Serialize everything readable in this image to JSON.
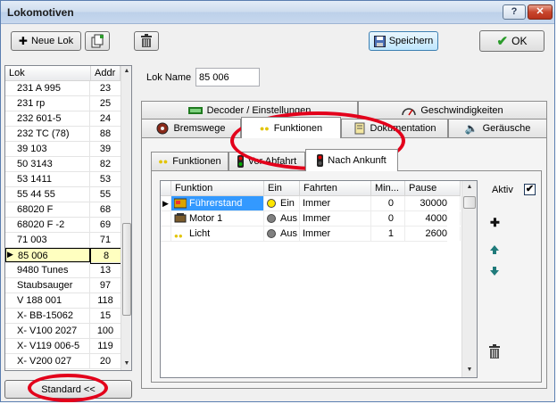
{
  "window": {
    "title": "Lokomotiven",
    "help_label": "?",
    "close_label": "✕"
  },
  "toolbar": {
    "new_loco_label": "Neue Lok",
    "save_label": "Speichern",
    "ok_label": "OK"
  },
  "loco_list": {
    "col_lok": "Lok",
    "col_addr": "Addr",
    "rows": [
      {
        "name": "231 A 995",
        "addr": "23"
      },
      {
        "name": "231 rp",
        "addr": "25"
      },
      {
        "name": "232 601-5",
        "addr": "24"
      },
      {
        "name": "232 TC (78)",
        "addr": "88"
      },
      {
        "name": "39 103",
        "addr": "39"
      },
      {
        "name": "50 3143",
        "addr": "82"
      },
      {
        "name": "53 1411",
        "addr": "53"
      },
      {
        "name": "55 44 55",
        "addr": "55"
      },
      {
        "name": "68020 F",
        "addr": "68"
      },
      {
        "name": "68020 F -2",
        "addr": "69"
      },
      {
        "name": "71 003",
        "addr": "71"
      },
      {
        "name": "85 006",
        "addr": "8"
      },
      {
        "name": "9480 Tunes",
        "addr": "13"
      },
      {
        "name": "Staubsauger",
        "addr": "97"
      },
      {
        "name": "V 188 001",
        "addr": "118"
      },
      {
        "name": "X- BB-15062",
        "addr": "15"
      },
      {
        "name": "X- V100 2027",
        "addr": "100"
      },
      {
        "name": "X- V119 006-5",
        "addr": "119"
      },
      {
        "name": "X- V200 027",
        "addr": "20"
      }
    ],
    "selected_index": 11,
    "standard_label": "Standard <<"
  },
  "lok_name": {
    "label": "Lok Name",
    "value": "85 006"
  },
  "tabs_top": [
    {
      "label": "Decoder / Einstellungen"
    },
    {
      "label": "Geschwindigkeiten"
    }
  ],
  "tabs_main": [
    {
      "label": "Bremswege"
    },
    {
      "label": "Funktionen"
    },
    {
      "label": "Dokumentation"
    },
    {
      "label": "Geräusche"
    }
  ],
  "subtabs": [
    {
      "label": "Funktionen"
    },
    {
      "label": "Vor Abfahrt"
    },
    {
      "label": "Nach Ankunft"
    }
  ],
  "functions_table": {
    "headers": [
      "Funktion",
      "Ein",
      "Fahrten",
      "Min...",
      "Pause"
    ],
    "rows": [
      {
        "name": "Führerstand",
        "ein": "Ein",
        "fahrten": "Immer",
        "min": "0",
        "pause": "30000",
        "dot": "#ffe600"
      },
      {
        "name": "Motor 1",
        "ein": "Aus",
        "fahrten": "Immer",
        "min": "0",
        "pause": "4000",
        "dot": "#808080"
      },
      {
        "name": "Licht",
        "ein": "Aus",
        "fahrten": "Immer",
        "min": "1",
        "pause": "2600",
        "dot": "#808080"
      }
    ]
  },
  "aktiv": {
    "label": "Aktiv",
    "checked": true,
    "check_mark": "✔"
  },
  "colors": {
    "highlight_ring": "#e3001b",
    "selected_row": "#ffffc0",
    "window_border": "#5a7eb0"
  }
}
